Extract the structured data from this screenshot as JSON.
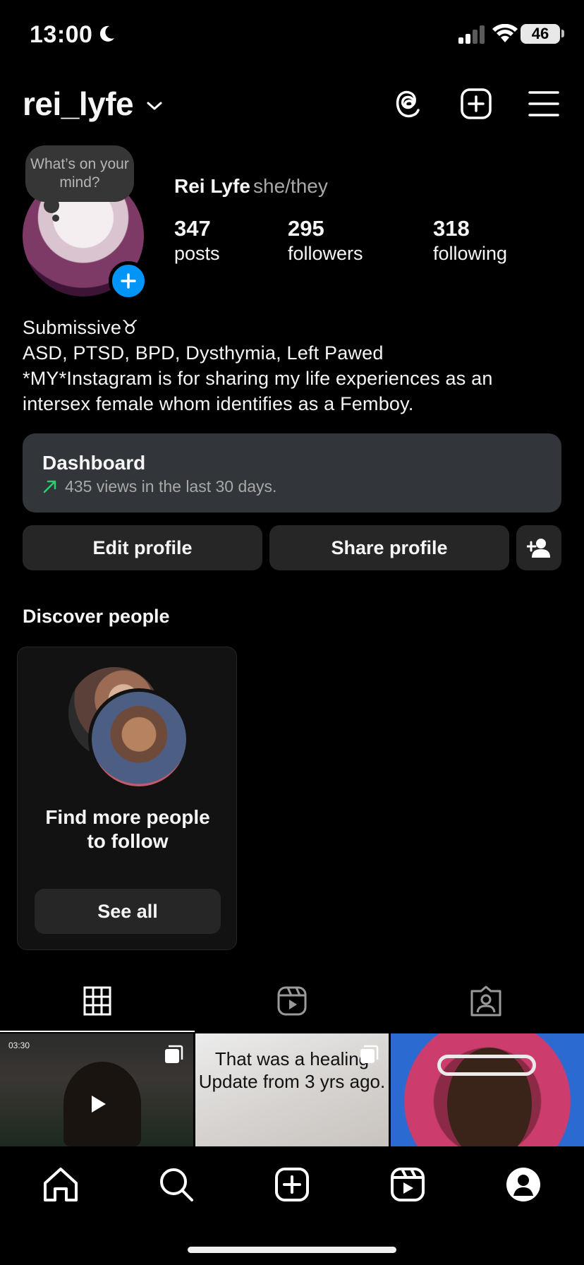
{
  "status_bar": {
    "time": "13:00",
    "battery": "46"
  },
  "header": {
    "username": "rei_lyfe"
  },
  "note": {
    "text": "What’s on your mind?"
  },
  "profile": {
    "full_name": "Rei Lyfe",
    "pronouns": "she/they",
    "stats": [
      {
        "value": "347",
        "label": "posts"
      },
      {
        "value": "295",
        "label": "followers"
      },
      {
        "value": "318",
        "label": "following"
      }
    ],
    "bio": [
      "Submissive♉",
      "ASD, PTSD, BPD, Dysthymia, Left Pawed",
      "*MY*Instagram is for sharing my life experiences as an",
      "intersex female whom identifies as a Femboy."
    ]
  },
  "dashboard": {
    "title": "Dashboard",
    "subtitle": "435 views in the last 30 days."
  },
  "buttons": {
    "edit_profile": "Edit profile",
    "share_profile": "Share profile"
  },
  "discover": {
    "title": "Discover people",
    "card_title": "Find more people to follow",
    "see_all": "See all"
  },
  "grid": {
    "tile1_time": "03:30",
    "tile2_text": "That was a healing Update from 3 yrs ago."
  },
  "colors": {
    "accent": "#0095f6",
    "card": "#262626",
    "dashboard": "#323539"
  }
}
